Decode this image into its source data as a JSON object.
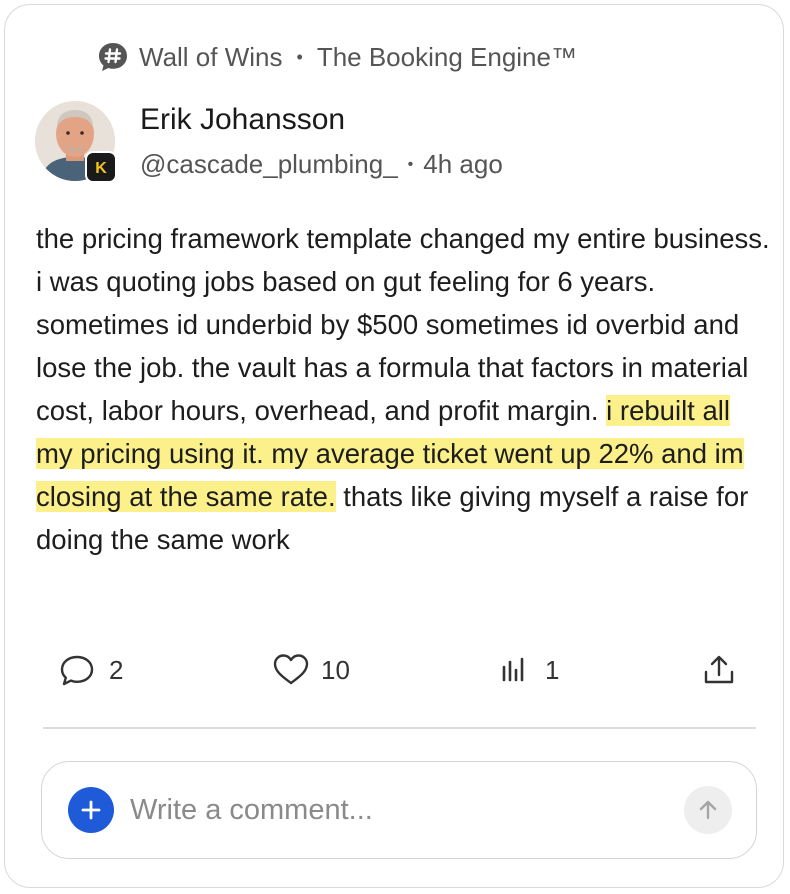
{
  "header": {
    "community": "Wall of Wins",
    "separator": "•",
    "space": "The Booking Engine™"
  },
  "post": {
    "author": "Erik Johansson",
    "handle": "@cascade_plumbing_",
    "meta_separator": "•",
    "time": "4h ago",
    "badge_letter": "K",
    "body_before": "the pricing framework template changed my entire business. i was quoting jobs based on gut feeling for 6 years. sometimes id underbid by $500 sometimes id overbid and lose the job. the vault has a formula that factors in material cost, labor hours, overhead, and profit margin. ",
    "body_highlight": "i rebuilt all my pricing using it. my average ticket went up 22% and im closing at the same rate.",
    "body_after": " thats like giving myself a raise for doing the same work"
  },
  "actions": {
    "comments": "2",
    "likes": "10",
    "views": "1"
  },
  "comment_box": {
    "placeholder": "Write a comment..."
  },
  "colors": {
    "highlight": "#fbf08a",
    "add_button": "#1f5bd8",
    "badge": "#1a1a1a",
    "badge_accent": "#f5c518"
  }
}
